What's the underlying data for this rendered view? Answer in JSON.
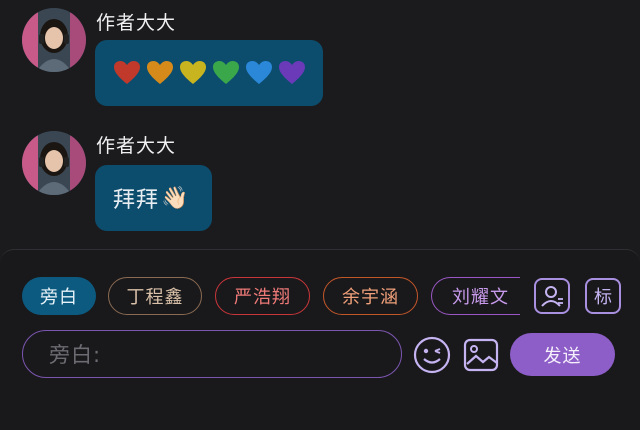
{
  "messages": [
    {
      "author": "作者大大",
      "type": "hearts",
      "hearts": [
        "#c0392b",
        "#d68a1a",
        "#c8b41e",
        "#3aa84a",
        "#2b88d8",
        "#6a3ab8"
      ]
    },
    {
      "author": "作者大大",
      "type": "text",
      "text": "拜拜",
      "emoji": "👋🏻"
    }
  ],
  "roles": {
    "narration": "旁白",
    "characters": [
      "丁程鑫",
      "严浩翔",
      "余宇涵",
      "刘耀文"
    ]
  },
  "tools": {
    "tag_label": "标"
  },
  "composer": {
    "placeholder": "旁白:",
    "send_label": "发送"
  },
  "colors": {
    "bubble": "#0c4d6e",
    "accent": "#8d5ec8"
  }
}
